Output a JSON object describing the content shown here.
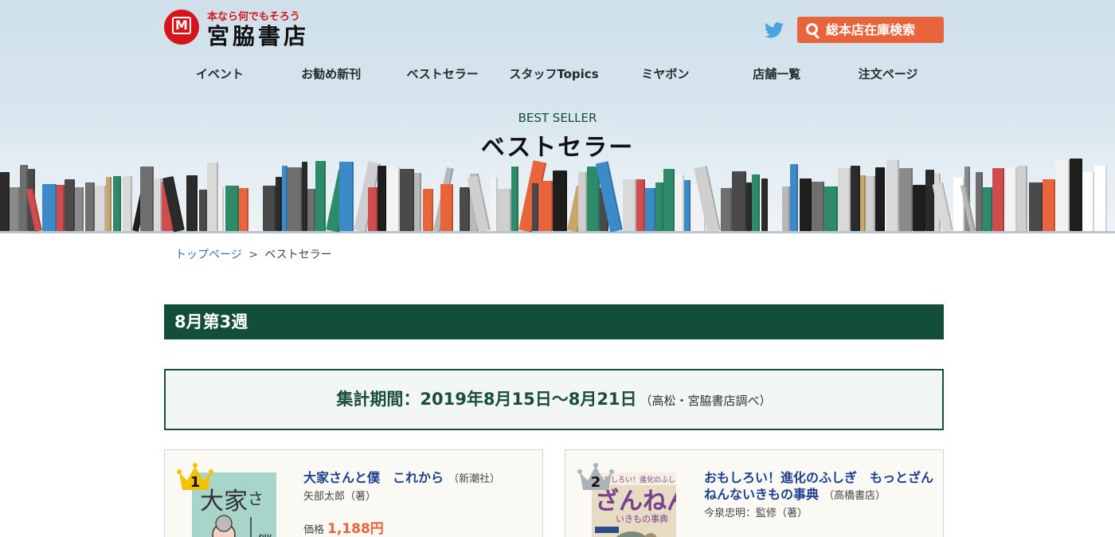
{
  "header": {
    "logo_tagline": "本なら何でもそろう",
    "logo_name": "宮脇書店",
    "logo_mark": "M",
    "search_label": "総本店在庫検索",
    "twitter_icon": "twitter-bird-icon",
    "accent_color": "#e9643b"
  },
  "nav": {
    "items": [
      {
        "label": "イベント"
      },
      {
        "label": "お勧め新刊"
      },
      {
        "label": "ベストセラー"
      },
      {
        "label": "スタッフTopics"
      },
      {
        "label": "ミヤボン"
      },
      {
        "label": "店舗一覧"
      },
      {
        "label": "注文ページ"
      }
    ]
  },
  "hero": {
    "subtitle": "BEST SELLER",
    "title": "ベストセラー"
  },
  "breadcrumb": {
    "home": "トップページ",
    "separator": ">",
    "current": "ベストセラー"
  },
  "week": {
    "label": "8月第3週",
    "bar_color": "#134d3c"
  },
  "period": {
    "main": "集計期間：2019年8月15日〜8月21日",
    "note": "（高松・宮脇書店調べ）"
  },
  "books": [
    {
      "rank": "1",
      "crown_color": "#f3c200",
      "title": "大家さんと僕　これから",
      "publisher": "（新潮社）",
      "author": "矢部太郎（著）",
      "price_label": "価格",
      "price": "1,188円"
    },
    {
      "rank": "2",
      "crown_color": "#a9b3b8",
      "title": "おもしろい！進化のふしぎ　もっとざんねんないきもの事典",
      "publisher": "（高橋書店）",
      "author": "今泉忠明：監修（著）"
    }
  ]
}
